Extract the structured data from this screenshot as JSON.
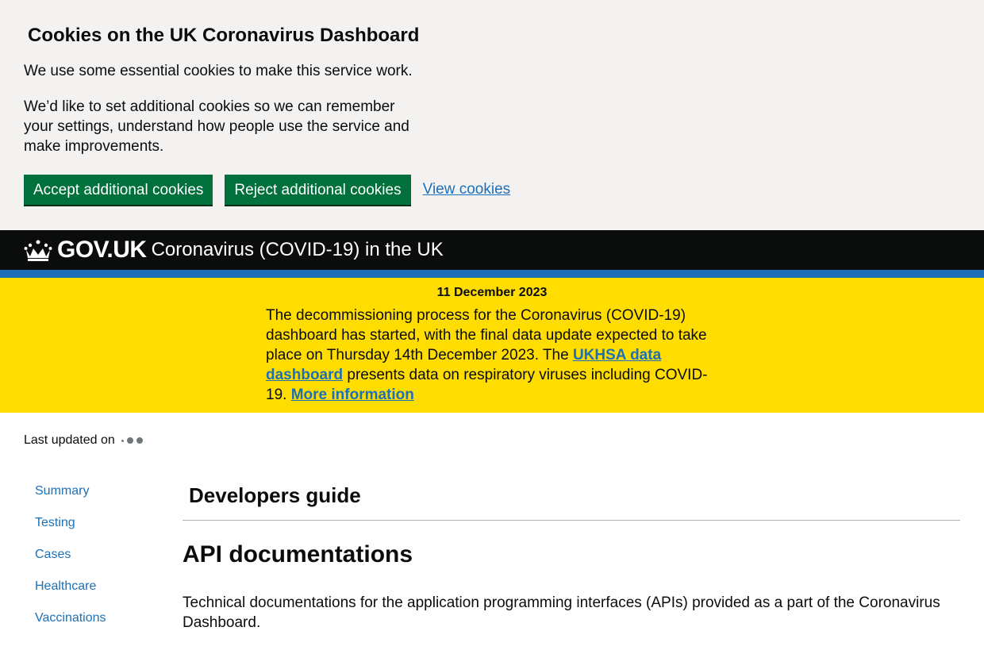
{
  "cookie_banner": {
    "title": "Cookies on the UK Coronavirus Dashboard",
    "text1": "We use some essential cookies to make this service work.",
    "text2": "We’d like to set additional cookies so we can remember your settings, understand how people use the service and make improvements.",
    "accept_label": "Accept additional cookies",
    "reject_label": "Reject additional cookies",
    "view_label": "View cookies"
  },
  "header": {
    "logo_icon": "crown-icon",
    "logo_text": "GOV.UK",
    "service_name": "Coronavirus (COVID-19) in the UK",
    "accent_color": "#1d70b8"
  },
  "announcement": {
    "date": "11 December 2023",
    "text_before": "The decommissioning process for the Coronavirus (COVID-19) dashboard has started, with the final data update expected to take place on Thursday 14th December 2023. The ",
    "link1": "UKHSA data dashboard",
    "text_after": " presents data on respiratory viruses including COVID-19. ",
    "link2": "More information",
    "background_color": "#ffdd00"
  },
  "last_updated": {
    "label": "Last updated on",
    "loading_icon": "loading-dots-icon"
  },
  "sidebar": {
    "items": [
      {
        "label": "Summary"
      },
      {
        "label": "Testing"
      },
      {
        "label": "Cases"
      },
      {
        "label": "Healthcare"
      },
      {
        "label": "Vaccinations"
      }
    ]
  },
  "main": {
    "page_title": "Developers guide",
    "heading": "API documentations",
    "description": "Technical documentations for the application programming interfaces (APIs) provided as a part of the Coronavirus Dashboard."
  }
}
